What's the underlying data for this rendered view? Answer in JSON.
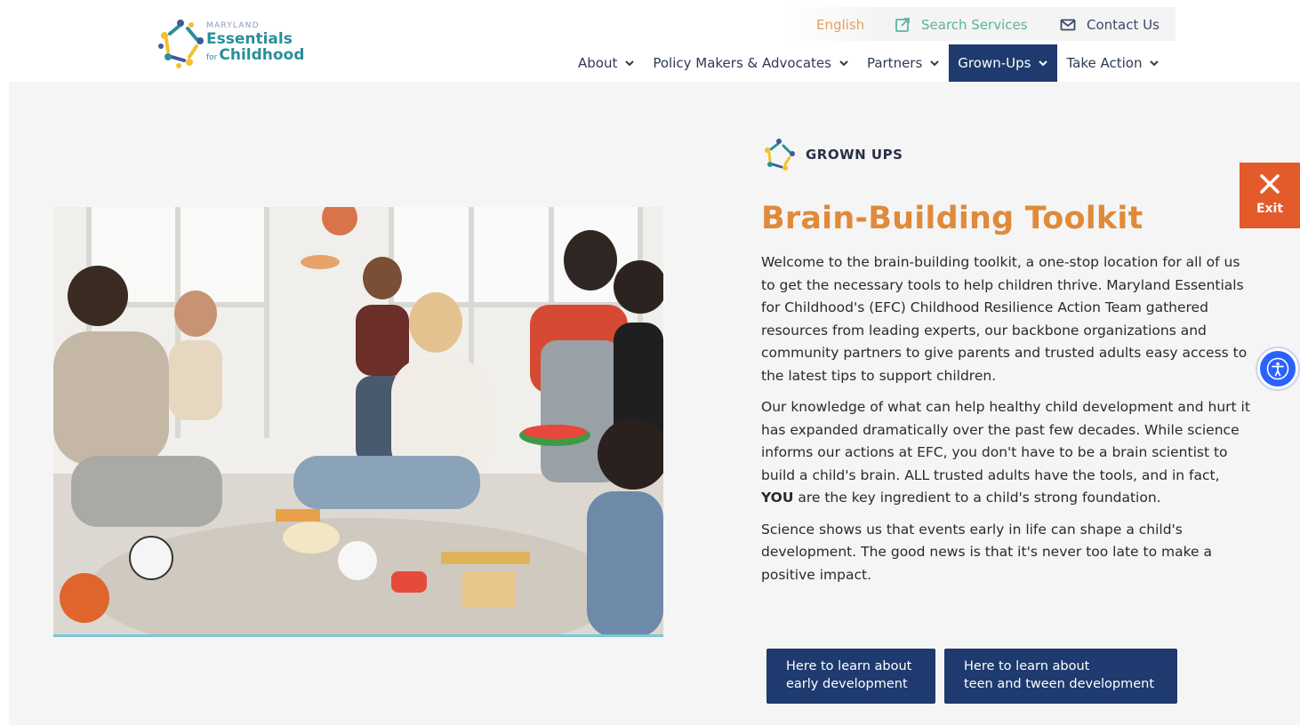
{
  "logo": {
    "line1": "MARYLAND",
    "line2": "Essentials",
    "line3_prefix": "for",
    "line3": "Childhood"
  },
  "utility": {
    "language": "English",
    "search": "Search Services",
    "contact": "Contact Us"
  },
  "nav": {
    "items": [
      {
        "label": "About"
      },
      {
        "label": "Policy Makers & Advocates"
      },
      {
        "label": "Partners"
      },
      {
        "label": "Grown-Ups"
      },
      {
        "label": "Take Action"
      }
    ],
    "active": "Grown-Ups"
  },
  "section": {
    "tag": "GROWN UPS",
    "title": "Brain-Building Toolkit"
  },
  "content": {
    "p1": "Welcome to the brain-building toolkit, a one-stop location for all of us to get the necessary tools to help children thrive. Maryland Essentials for Childhood's (EFC) Childhood Resilience Action Team gathered resources from leading experts, our backbone organizations and community partners to give parents and trusted adults easy access to the latest tips to support children.",
    "p2_before": "Our knowledge of what can help healthy child development and hurt it has expanded dramatically over the past few decades. While science informs our actions at EFC, you don't have to be a brain scientist to build a child's brain. ALL trusted adults have the tools, and in fact, ",
    "p2_bold": "YOU",
    "p2_after": " are the key ingredient to a child's strong foundation.",
    "p3": "Science shows us that events early in life can shape a child's development. The good news is that it's never too late to make a positive impact."
  },
  "buttons": {
    "early_line1": "Here to learn about",
    "early_line2": "early development",
    "teen_line1": "Here to learn about",
    "teen_line2": "teen and tween development"
  },
  "exit": {
    "label": "Exit"
  },
  "colors": {
    "navy": "#1e3a6e",
    "title_orange": "#e08a3a",
    "exit_orange": "#e35b2a",
    "teal": "#2b8f9a",
    "a11y_blue": "#2962ff"
  }
}
